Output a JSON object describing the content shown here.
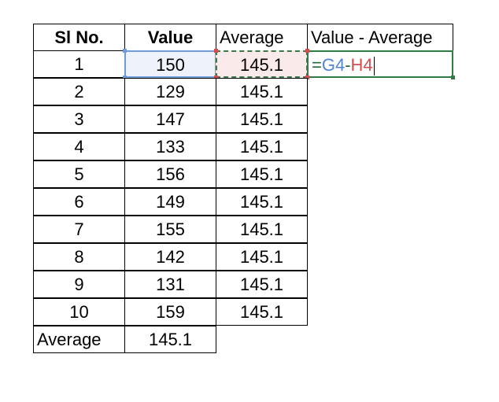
{
  "table": {
    "headers": [
      "Sl No.",
      "Value",
      "Average",
      "Value - Average"
    ],
    "rows": [
      {
        "sl": "1",
        "value": "150",
        "avg": "145.1"
      },
      {
        "sl": "2",
        "value": "129",
        "avg": "145.1"
      },
      {
        "sl": "3",
        "value": "147",
        "avg": "145.1"
      },
      {
        "sl": "4",
        "value": "133",
        "avg": "145.1"
      },
      {
        "sl": "5",
        "value": "156",
        "avg": "145.1"
      },
      {
        "sl": "6",
        "value": "149",
        "avg": "145.1"
      },
      {
        "sl": "7",
        "value": "155",
        "avg": "145.1"
      },
      {
        "sl": "8",
        "value": "142",
        "avg": "145.1"
      },
      {
        "sl": "9",
        "value": "131",
        "avg": "145.1"
      },
      {
        "sl": "10",
        "value": "159",
        "avg": "145.1"
      }
    ],
    "footer": {
      "label": "Average",
      "value": "145.1"
    }
  },
  "formula": {
    "equals": "=",
    "ref1": "G4",
    "operator": "-",
    "ref2": "H4"
  },
  "colors": {
    "ref1_color": "#4f86d4",
    "ref2_color": "#d24e4e",
    "active_border": "#2f7d44"
  }
}
